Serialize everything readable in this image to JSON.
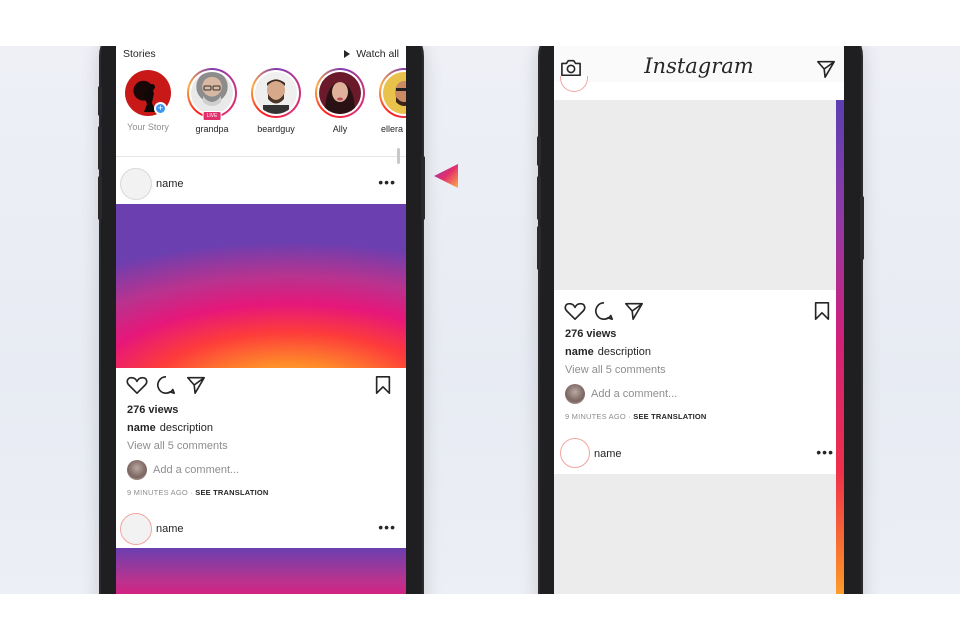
{
  "left_phone": {
    "stories_title": "Stories",
    "watch_all": "Watch all",
    "stories": [
      {
        "label": "Your Story",
        "add_badge": "+"
      },
      {
        "label": "grandpa",
        "live_badge": "LIVE"
      },
      {
        "label": "beardguy"
      },
      {
        "label": "Ally"
      },
      {
        "label": "ellera"
      }
    ],
    "post1": {
      "username": "name",
      "more": "•••",
      "views": "276 views",
      "desc_user": "name",
      "desc_text": "description",
      "view_all": "View all 5 comments",
      "add_comment": "Add a comment...",
      "time": "9 MINUTES AGO",
      "separator": "·",
      "translation": "SEE TRANSLATION"
    },
    "post2": {
      "username": "name",
      "more": "•••"
    }
  },
  "right_phone": {
    "logo": "Instagram",
    "views": "276 views",
    "desc_user": "name",
    "desc_text": "description",
    "view_all": "View all 5 comments",
    "add_comment": "Add a comment...",
    "time": "9 MINUTES AGO",
    "separator": "·",
    "translation": "SEE TRANSLATION",
    "next_post_user": "name",
    "next_post_more": "•••"
  },
  "colors": {
    "accent_pink": "#e1306c",
    "accent_purple": "#833ab4",
    "accent_orange": "#fcaf45",
    "link_blue": "#3897f0"
  }
}
